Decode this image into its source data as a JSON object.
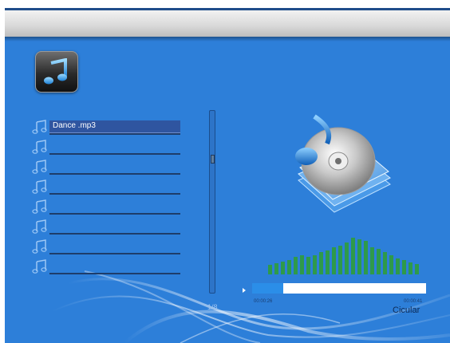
{
  "playlist": {
    "items": [
      {
        "label": "Dance .mp3",
        "selected": true
      },
      {
        "label": "",
        "selected": false
      },
      {
        "label": "",
        "selected": false
      },
      {
        "label": "",
        "selected": false
      },
      {
        "label": "",
        "selected": false
      },
      {
        "label": "",
        "selected": false
      },
      {
        "label": "",
        "selected": false
      },
      {
        "label": "",
        "selected": false
      }
    ],
    "page": "1/8"
  },
  "player": {
    "elapsed": "00:00:26",
    "total": "00:00:41",
    "progress_fraction": 0.18,
    "mode": "Cicular"
  },
  "icons": {
    "app": "music-note-icon",
    "row": "music-note-icon",
    "art": "cd-music-icon"
  },
  "colors": {
    "background": "#2d7fd9",
    "progress_fill": "#2b8ee8",
    "equalizer": "#2e9a4a"
  }
}
